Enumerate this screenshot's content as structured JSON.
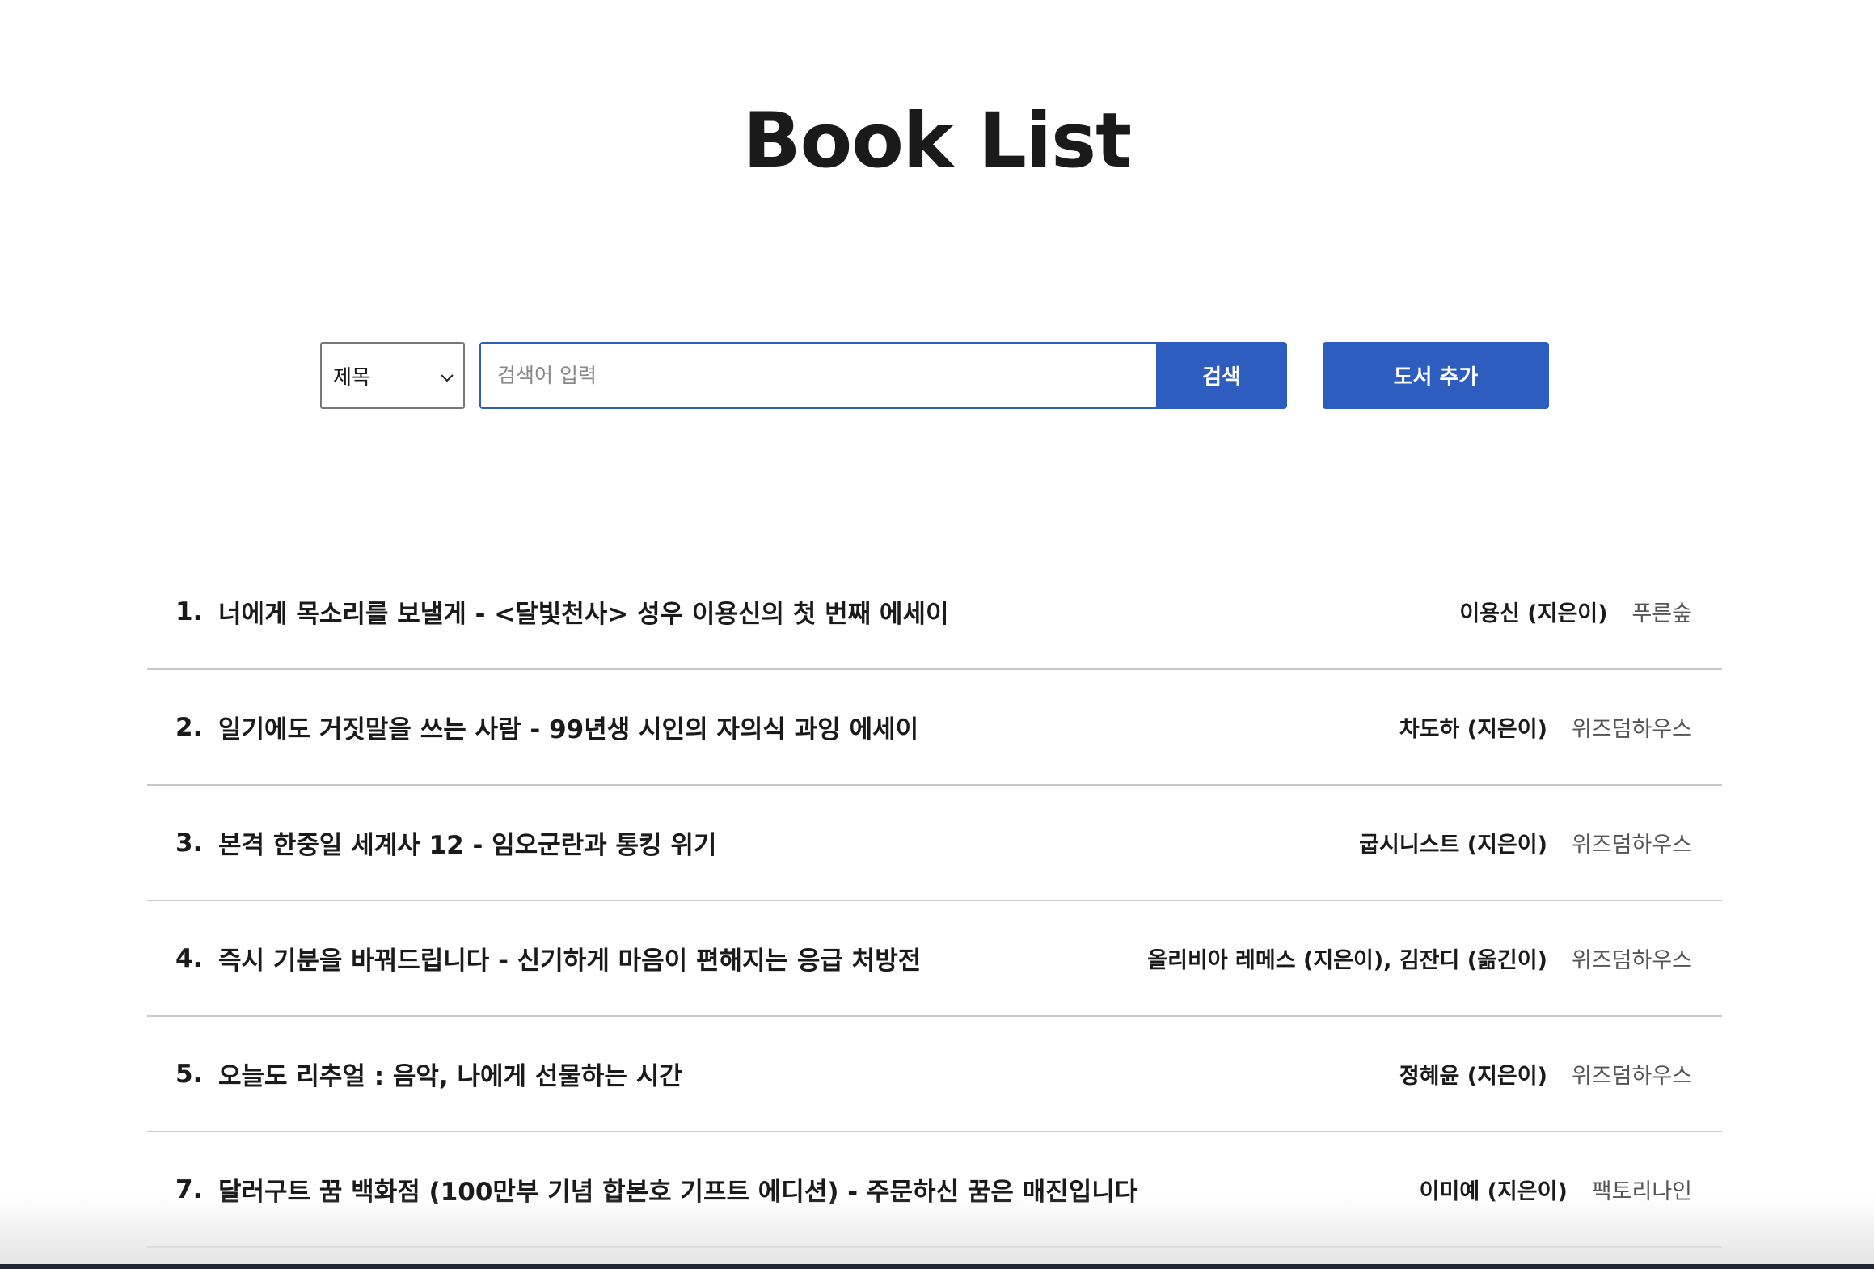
{
  "page": {
    "title": "Book List"
  },
  "search": {
    "field_selected": "제목",
    "placeholder": "검색어 입력",
    "value": "",
    "search_label": "검색",
    "add_label": "도서 추가"
  },
  "colors": {
    "accent": "#2d5dbe"
  },
  "books": [
    {
      "num": "1.",
      "title": "너에게 목소리를 보낼게 - <달빛천사> 성우 이용신의 첫 번째 에세이",
      "author": "이용신 (지은이)",
      "publisher": "푸른숲"
    },
    {
      "num": "2.",
      "title": "일기에도 거짓말을 쓰는 사람 - 99년생 시인의 자의식 과잉 에세이",
      "author": "차도하 (지은이)",
      "publisher": "위즈덤하우스"
    },
    {
      "num": "3.",
      "title": "본격 한중일 세계사 12 - 임오군란과 통킹 위기",
      "author": "굽시니스트 (지은이)",
      "publisher": "위즈덤하우스"
    },
    {
      "num": "4.",
      "title": "즉시 기분을 바꿔드립니다 - 신기하게 마음이 편해지는 응급 처방전",
      "author": "올리비아 레메스 (지은이), 김잔디 (옮긴이)",
      "publisher": "위즈덤하우스"
    },
    {
      "num": "5.",
      "title": "오늘도 리추얼 : 음악, 나에게 선물하는 시간",
      "author": "정혜윤 (지은이)",
      "publisher": "위즈덤하우스"
    },
    {
      "num": "7.",
      "title": "달러구트 꿈 백화점 (100만부 기념 합본호 기프트 에디션) - 주문하신 꿈은 매진입니다",
      "author": "이미예 (지은이)",
      "publisher": "팩토리나인"
    }
  ]
}
